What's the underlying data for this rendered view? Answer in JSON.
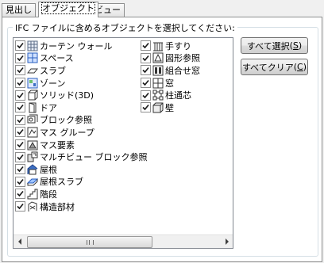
{
  "tabs": [
    {
      "label": "見出し",
      "active": false
    },
    {
      "label": "オブジェクト",
      "active": true
    },
    {
      "label": "ビュー",
      "active": false
    }
  ],
  "group_label": "IFC ファイルに含めるオブジェクトを選択してください:",
  "column1": [
    {
      "label": "カーテン ウォール",
      "checked": true,
      "icon": "curtain-wall-icon"
    },
    {
      "label": "スペース",
      "checked": true,
      "icon": "space-icon"
    },
    {
      "label": "スラブ",
      "checked": true,
      "icon": "slab-icon"
    },
    {
      "label": "ゾーン",
      "checked": true,
      "icon": "zone-icon"
    },
    {
      "label": "ソリッド(3D)",
      "checked": true,
      "icon": "solid-3d-icon"
    },
    {
      "label": "ドア",
      "checked": true,
      "icon": "door-icon"
    },
    {
      "label": "ブロック参照",
      "checked": true,
      "icon": "block-reference-icon"
    },
    {
      "label": "マス グループ",
      "checked": true,
      "icon": "mass-group-icon"
    },
    {
      "label": "マス要素",
      "checked": true,
      "icon": "mass-element-icon"
    },
    {
      "label": "マルチビュー ブロック参照",
      "checked": true,
      "icon": "multiview-block-icon"
    },
    {
      "label": "屋根",
      "checked": true,
      "icon": "roof-icon"
    },
    {
      "label": "屋根スラブ",
      "checked": true,
      "icon": "roof-slab-icon"
    },
    {
      "label": "階段",
      "checked": true,
      "icon": "stair-icon"
    },
    {
      "label": "構造部材",
      "checked": true,
      "icon": "structural-member-icon"
    }
  ],
  "column2": [
    {
      "label": "手すり",
      "checked": true,
      "icon": "railing-icon"
    },
    {
      "label": "図形参照",
      "checked": true,
      "icon": "shape-reference-icon"
    },
    {
      "label": "組合せ窓",
      "checked": true,
      "icon": "window-assembly-icon"
    },
    {
      "label": "窓",
      "checked": true,
      "icon": "window-icon"
    },
    {
      "label": "柱通芯",
      "checked": true,
      "icon": "column-grid-icon"
    },
    {
      "label": "壁",
      "checked": true,
      "icon": "wall-icon"
    }
  ],
  "buttons": {
    "select_all": "すべて選択",
    "select_all_key": "S",
    "clear_all": "すべてクリア",
    "clear_all_key": "C"
  },
  "colors": {
    "check": "#1a1a1a",
    "border": "#8e8f8f",
    "icon_blue": "#3c6fc4"
  }
}
